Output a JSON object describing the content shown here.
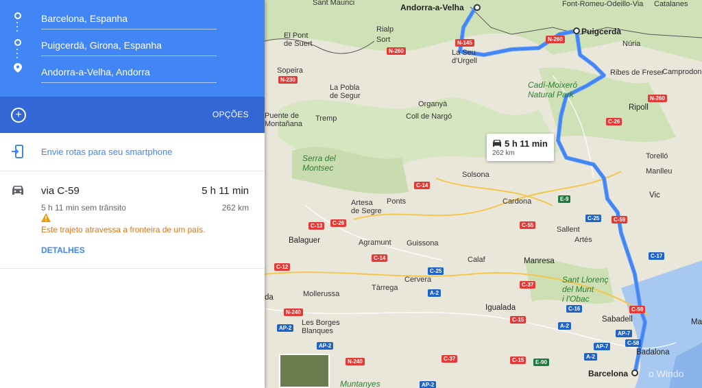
{
  "directions": {
    "waypoints": [
      {
        "value": "Barcelona, Espanha"
      },
      {
        "value": "Puigcerdà, Girona, Espanha"
      },
      {
        "value": "Andorra-a-Velha, Andorra"
      }
    ],
    "options_label": "OPÇÕES",
    "send_label": "Envie rotas para seu smartphone",
    "route": {
      "name": "via C-59",
      "time": "5 h 11 min",
      "subtitle": "5 h 11 min sem trânsito",
      "distance": "262 km",
      "warning": "Este trajeto atravessa a fronteira de um país.",
      "details_label": "DETALHES"
    }
  },
  "map": {
    "route_card": {
      "time": "5 h 11 min",
      "distance": "262 km"
    },
    "places": [
      {
        "id": "andorra",
        "text": "Andorra-a-Velha",
        "cls": "big"
      },
      {
        "id": "puigcerda",
        "text": "Puigcerdà",
        "cls": "big"
      },
      {
        "id": "barcelona",
        "text": "Barcelona",
        "cls": "big"
      },
      {
        "id": "santmaurici",
        "text": "Sant Maurici",
        "cls": ""
      },
      {
        "id": "fontromeu",
        "text": "Font-Romeu-Odeillo-Via",
        "cls": ""
      },
      {
        "id": "catalanes",
        "text": "Catalanes",
        "cls": ""
      },
      {
        "id": "riallp",
        "text": "Rialp",
        "cls": ""
      },
      {
        "id": "sort",
        "text": "Sort",
        "cls": ""
      },
      {
        "id": "elpont",
        "text": "El Pont\nde Suert",
        "cls": ""
      },
      {
        "id": "laseu",
        "text": "La Seu\nd'Urgell",
        "cls": ""
      },
      {
        "id": "nuria",
        "text": "Núria",
        "cls": ""
      },
      {
        "id": "sopeira",
        "text": "Sopeira",
        "cls": ""
      },
      {
        "id": "ribes",
        "text": "Ribes de Freser",
        "cls": ""
      },
      {
        "id": "camprodon",
        "text": "Camprodon",
        "cls": ""
      },
      {
        "id": "cadi",
        "text": "Cadí-Moixeró\nNatural Park",
        "cls": "park"
      },
      {
        "id": "lapobla",
        "text": "La Pobla\nde Segur",
        "cls": ""
      },
      {
        "id": "organya",
        "text": "Organyà",
        "cls": ""
      },
      {
        "id": "puente",
        "text": "Puente de\nMontañana",
        "cls": ""
      },
      {
        "id": "tremp",
        "text": "Tremp",
        "cls": ""
      },
      {
        "id": "collnargo",
        "text": "Coll de Nargó",
        "cls": ""
      },
      {
        "id": "ripoll",
        "text": "Ripoll",
        "cls": "city"
      },
      {
        "id": "serra",
        "text": "Serra del\nMontsec",
        "cls": "park"
      },
      {
        "id": "torello",
        "text": "Torelló",
        "cls": ""
      },
      {
        "id": "manlleu",
        "text": "Manlleu",
        "cls": ""
      },
      {
        "id": "solsona",
        "text": "Solsona",
        "cls": ""
      },
      {
        "id": "artesa",
        "text": "Artesa\nde Segre",
        "cls": ""
      },
      {
        "id": "ponts",
        "text": "Ponts",
        "cls": ""
      },
      {
        "id": "cardona",
        "text": "Cardona",
        "cls": ""
      },
      {
        "id": "vic",
        "text": "Vic",
        "cls": "city"
      },
      {
        "id": "sallent",
        "text": "Sallent",
        "cls": ""
      },
      {
        "id": "artes",
        "text": "Artés",
        "cls": ""
      },
      {
        "id": "balaguer",
        "text": "Balaguer",
        "cls": "city"
      },
      {
        "id": "agramunt",
        "text": "Agramunt",
        "cls": ""
      },
      {
        "id": "guissona",
        "text": "Guissona",
        "cls": ""
      },
      {
        "id": "calaf",
        "text": "Calaf",
        "cls": ""
      },
      {
        "id": "manresa",
        "text": "Manresa",
        "cls": "city"
      },
      {
        "id": "cervera",
        "text": "Cervera",
        "cls": ""
      },
      {
        "id": "tarrega",
        "text": "Tàrrega",
        "cls": ""
      },
      {
        "id": "mollerussa",
        "text": "Mollerussa",
        "cls": ""
      },
      {
        "id": "santllorenc",
        "text": "Sant Llorenç\ndel Munt\ni l'Obac",
        "cls": "park"
      },
      {
        "id": "igualada",
        "text": "Igualada",
        "cls": "city"
      },
      {
        "id": "sabadell",
        "text": "Sabadell",
        "cls": "city"
      },
      {
        "id": "lesborges",
        "text": "Les Borges\nBlanques",
        "cls": ""
      },
      {
        "id": "badalona",
        "text": "Badalona",
        "cls": "city"
      },
      {
        "id": "muntanyes",
        "text": "Muntanyes",
        "cls": "park"
      },
      {
        "id": "mat",
        "text": "Mat",
        "cls": "city"
      },
      {
        "id": "da",
        "text": "da",
        "cls": "city"
      }
    ],
    "shields": [
      "N-145",
      "N-260",
      "N-260",
      "N-230",
      "N-260",
      "C-26",
      "C-14",
      "C-13",
      "C-26",
      "E-9",
      "C-25",
      "C-59",
      "C-55",
      "C-17",
      "C-12",
      "C-14",
      "C-25",
      "C-37",
      "A-2",
      "C-16",
      "C-59",
      "N-240",
      "C-15",
      "A-2",
      "AP-7",
      "AP-2",
      "C-58",
      "AP-2",
      "C-37",
      "N-240",
      "C-15",
      "E-90",
      "A-2",
      "AP-7",
      "AP-2"
    ],
    "watermark": "o Windo"
  }
}
